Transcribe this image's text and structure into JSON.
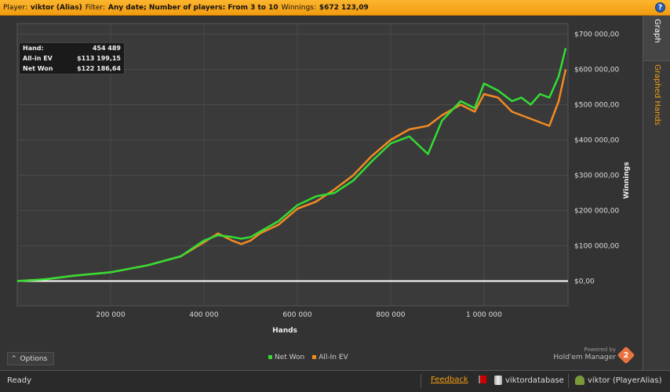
{
  "header": {
    "player_label": "Player:",
    "player_value": "viktor (Alias)",
    "filter_label": "Filter:",
    "filter_value": "Any date; Number of players: From 3 to 10",
    "winnings_label": "Winnings:",
    "winnings_value": "$672 123,09",
    "help": "?"
  },
  "side_tabs": {
    "graph": "Graph",
    "graphed_hands": "Graphed Hands"
  },
  "summary": [
    {
      "label": "Hand:",
      "value": "454 489"
    },
    {
      "label": "All-in EV",
      "value": "$113 199,15"
    },
    {
      "label": "Net Won",
      "value": "$122 186,64"
    }
  ],
  "options_label": "Options",
  "legend": [
    {
      "name": "Net Won",
      "color": "#33dd33"
    },
    {
      "name": "All-In EV",
      "color": "#f28a22"
    }
  ],
  "brand": {
    "powered_by": "Powered by",
    "name": "Hold'em Manager",
    "logo_num": "2"
  },
  "status": {
    "ready": "Ready",
    "feedback": "Feedback",
    "database": "viktordatabase",
    "user": "viktor (PlayerAlias)"
  },
  "chart_data": {
    "type": "line",
    "xlabel": "Hands",
    "ylabel": "Winnings",
    "xlim": [
      0,
      1180000
    ],
    "ylim": [
      -70000,
      730000
    ],
    "x_ticks": [
      200000,
      400000,
      600000,
      800000,
      1000000
    ],
    "x_tick_labels": [
      "200 000",
      "400 000",
      "600 000",
      "800 000",
      "1 000 000"
    ],
    "y_ticks": [
      0,
      100000,
      200000,
      300000,
      400000,
      500000,
      600000,
      700000
    ],
    "y_tick_labels": [
      "$0,00",
      "$100 000,00",
      "$200 000,00",
      "$300 000,00",
      "$400 000,00",
      "$500 000,00",
      "$600 000,00",
      "$700 000,00"
    ],
    "grid": true,
    "series": [
      {
        "name": "All-In EV",
        "color": "#f28a22",
        "x": [
          0,
          60000,
          120000,
          200000,
          280000,
          350000,
          400000,
          430000,
          460000,
          480000,
          500000,
          520000,
          560000,
          600000,
          640000,
          680000,
          720000,
          760000,
          800000,
          840000,
          880000,
          910000,
          950000,
          980000,
          1000000,
          1030000,
          1060000,
          1080000,
          1100000,
          1120000,
          1140000,
          1160000,
          1175000
        ],
        "y": [
          0,
          5000,
          15000,
          25000,
          45000,
          70000,
          110000,
          135000,
          115000,
          105000,
          115000,
          135000,
          160000,
          205000,
          225000,
          260000,
          300000,
          355000,
          400000,
          430000,
          440000,
          470000,
          500000,
          480000,
          530000,
          520000,
          480000,
          470000,
          460000,
          450000,
          440000,
          510000,
          600000
        ]
      },
      {
        "name": "Net Won",
        "color": "#33dd33",
        "x": [
          0,
          60000,
          120000,
          200000,
          280000,
          350000,
          400000,
          430000,
          460000,
          480000,
          500000,
          520000,
          560000,
          600000,
          640000,
          680000,
          720000,
          760000,
          800000,
          840000,
          880000,
          910000,
          950000,
          980000,
          1000000,
          1030000,
          1060000,
          1080000,
          1100000,
          1120000,
          1140000,
          1160000,
          1175000
        ],
        "y": [
          0,
          5000,
          15000,
          25000,
          45000,
          70000,
          115000,
          130000,
          125000,
          120000,
          125000,
          140000,
          170000,
          215000,
          240000,
          250000,
          285000,
          340000,
          390000,
          410000,
          360000,
          455000,
          510000,
          490000,
          560000,
          540000,
          510000,
          520000,
          500000,
          530000,
          520000,
          580000,
          660000
        ]
      }
    ]
  }
}
